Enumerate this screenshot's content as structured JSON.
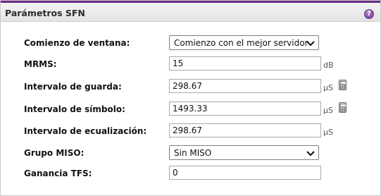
{
  "panel": {
    "title": "Parámetros SFN",
    "help_symbol": "?"
  },
  "fields": {
    "window_start": {
      "label": "Comienzo de ventana:",
      "value": "Comienzo con el mejor servidor"
    },
    "mrms": {
      "label": "MRMS:",
      "value": "15",
      "unit": "dB"
    },
    "guard_interval": {
      "label": "Intervalo de guarda:",
      "value": "298.67",
      "unit": "μS",
      "icon": "calculator-icon"
    },
    "symbol_interval": {
      "label": "Intervalo de símbolo:",
      "value": "1493.33",
      "unit": "μS",
      "icon": "calculator-icon"
    },
    "equalization_interval": {
      "label": "Intervalo de ecualización:",
      "value": "298.67",
      "unit": "μS"
    },
    "miso_group": {
      "label": "Grupo MISO:",
      "value": "Sin MISO"
    },
    "tfs_gain": {
      "label": "Ganancia TFS:",
      "value": "0"
    }
  },
  "colors": {
    "header_accent": "#6b2c85",
    "help_icon": "#7d4a9e"
  }
}
